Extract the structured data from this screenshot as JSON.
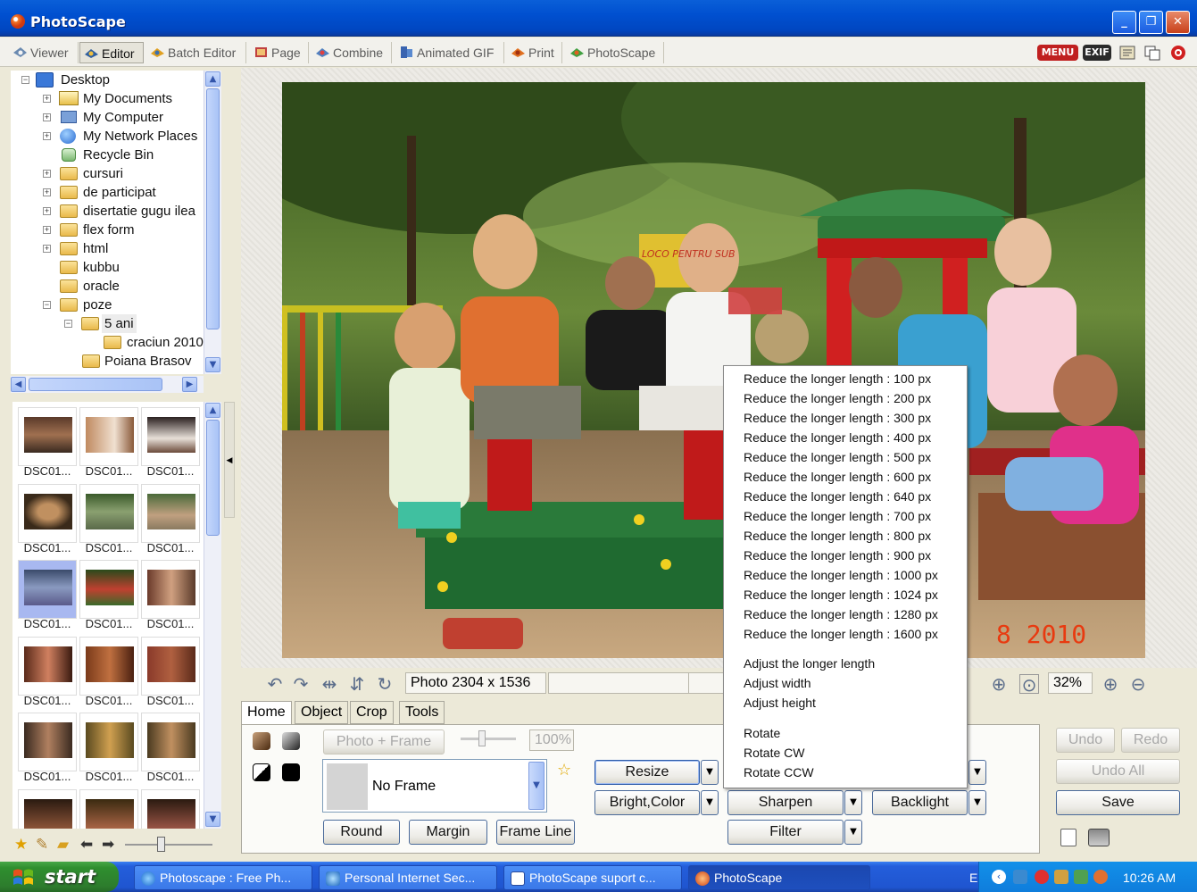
{
  "window": {
    "title": "PhotoScape",
    "buttons": [
      "_",
      "❐",
      "✕"
    ]
  },
  "modes": [
    {
      "label": "Viewer",
      "active": false
    },
    {
      "label": "Editor",
      "active": true
    },
    {
      "label": "Batch Editor",
      "active": false
    },
    {
      "label": "Page",
      "active": false
    },
    {
      "label": "Combine",
      "active": false
    },
    {
      "label": "Animated GIF",
      "active": false
    },
    {
      "label": "Print",
      "active": false
    },
    {
      "label": "PhotoScape",
      "active": false
    }
  ],
  "topright": {
    "menu_label": "MENU",
    "exif_label": "EXIF"
  },
  "tree": {
    "items": [
      {
        "label": "Desktop",
        "expander": "−"
      },
      {
        "label": "My Documents",
        "expander": "+"
      },
      {
        "label": "My Computer",
        "expander": "+"
      },
      {
        "label": "My Network Places",
        "expander": "+"
      },
      {
        "label": "Recycle Bin",
        "expander": ""
      },
      {
        "label": "cursuri",
        "expander": "+"
      },
      {
        "label": "de participat",
        "expander": "+"
      },
      {
        "label": "disertatie gugu ilea",
        "expander": "+"
      },
      {
        "label": "flex form",
        "expander": "+"
      },
      {
        "label": "html",
        "expander": "+"
      },
      {
        "label": "kubbu",
        "expander": ""
      },
      {
        "label": "oracle",
        "expander": ""
      },
      {
        "label": "poze",
        "expander": "−"
      },
      {
        "label": "5 ani",
        "expander": "−"
      },
      {
        "label": "craciun 2010",
        "expander": ""
      },
      {
        "label": "Poiana Brasov",
        "expander": ""
      }
    ]
  },
  "thumbnails": {
    "captions": [
      "DSC01...",
      "DSC01...",
      "DSC01...",
      "DSC01...",
      "DSC01...",
      "DSC01...",
      "DSC01...",
      "DSC01...",
      "DSC01...",
      "DSC01...",
      "DSC01...",
      "DSC01...",
      "DSC01...",
      "DSC01...",
      "DSC01..."
    ]
  },
  "photo": {
    "date_stamp": "8 2010",
    "sign_text": "LOCO PENTRU SUB"
  },
  "toolbar": {
    "photo_info": "Photo 2304 x 1536",
    "zoom": "32%"
  },
  "editor_tabs": [
    "Home",
    "Object",
    "Crop",
    "Tools"
  ],
  "home": {
    "photo_frame_label": "Photo + Frame",
    "frame_percent": "100%",
    "frame_name": "No Frame",
    "round_label": "Round",
    "margin_label": "Margin",
    "frame_line_label": "Frame Line",
    "resize_label": "Resize",
    "bright_color_label": "Bright,Color",
    "sharpen_label": "Sharpen",
    "backlight_label": "Backlight",
    "filter_label": "Filter",
    "undo_label": "Undo",
    "redo_label": "Redo",
    "undo_all_label": "Undo All",
    "save_label": "Save"
  },
  "resize_menu": {
    "reduce": [
      "Reduce the longer length : 100 px",
      "Reduce the longer length : 200 px",
      "Reduce the longer length : 300 px",
      "Reduce the longer length : 400 px",
      "Reduce the longer length : 500 px",
      "Reduce the longer length : 600 px",
      "Reduce the longer length : 640 px",
      "Reduce the longer length : 700 px",
      "Reduce the longer length : 800 px",
      "Reduce the longer length : 900 px",
      "Reduce the longer length : 1000 px",
      "Reduce the longer length : 1024 px",
      "Reduce the longer length : 1280 px",
      "Reduce the longer length : 1600 px"
    ],
    "adjust": [
      "Adjust the longer length",
      "Adjust width",
      "Adjust height"
    ],
    "rotate": [
      "Rotate",
      "Rotate CW",
      "Rotate CCW"
    ]
  },
  "taskbar": {
    "start_label": "start",
    "items": [
      {
        "label": "Photoscape : Free Ph...",
        "active": false
      },
      {
        "label": "Personal Internet Sec...",
        "active": false
      },
      {
        "label": "PhotoScape suport c...",
        "active": false
      },
      {
        "label": "PhotoScape",
        "active": true
      }
    ],
    "lang": "EN",
    "clock": "10:26 AM"
  }
}
